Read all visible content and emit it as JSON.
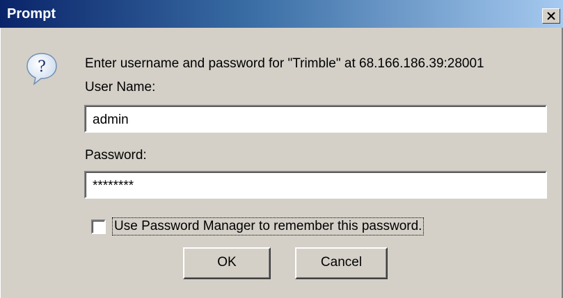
{
  "window": {
    "title": "Prompt"
  },
  "dialog": {
    "message": "Enter username and password for \"Trimble\" at 68.166.186.39:28001",
    "username_label": "User Name:",
    "username_value": "admin",
    "password_label": "Password:",
    "password_value": "********",
    "remember_label": "Use Password Manager to remember this password.",
    "remember_checked": false
  },
  "buttons": {
    "ok_label": "OK",
    "cancel_label": "Cancel"
  },
  "icons": {
    "dialog_icon": "question-bubble-icon",
    "close_icon": "close-icon"
  },
  "colors": {
    "titlebar_start": "#0a246a",
    "titlebar_end": "#a6caf0",
    "dialog_bg": "#d4d0c8"
  }
}
